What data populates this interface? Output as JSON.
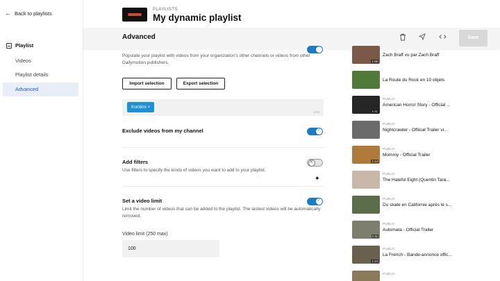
{
  "sidebar": {
    "back_label": "Back to playlists",
    "section_label": "Playlist",
    "items": [
      {
        "label": "Videos"
      },
      {
        "label": "Playlist details"
      },
      {
        "label": "Advanced"
      }
    ]
  },
  "header": {
    "breadcrumb": "PLAYLISTS",
    "title": "My dynamic playlist"
  },
  "toolbar": {
    "section_title": "Advanced",
    "save_label": "Save"
  },
  "main": {
    "intro": "Populate your playlist with videos from your organization's other channels or videos from other Dailymotion publishers.",
    "import_label": "Import selection",
    "export_label": "Export selection",
    "tag": "Konbini ×",
    "tag_counter": "1/10",
    "exclude_title": "Exclude videos from my channel",
    "filters_title": "Add filters",
    "filters_desc": "Use filters to specify the kinds of videos you want to add to your playlist.",
    "limit_title": "Set a video limit",
    "limit_desc": "Limit the number of videos that can be added to the playlist. The lastest videos will be automatically removed.",
    "limit_field_label": "Video limit (250 max)",
    "limit_value": "100"
  },
  "videos": [
    {
      "status": "",
      "title": "Zach Braff vu par Zach Braff",
      "duration": "1:08",
      "color": "#7a5a46"
    },
    {
      "status": "",
      "title": "La Route du Rock en 10 objets",
      "duration": "",
      "color": "#4f7a3a"
    },
    {
      "status": "PUBLIC",
      "title": "American Horror Story - Official ...",
      "duration": "1:11",
      "color": "#262626"
    },
    {
      "status": "PUBLIC",
      "title": "Nightcrawler - Official Trailer vi...",
      "duration": "",
      "color": "#6b6b6b"
    },
    {
      "status": "PUBLIC",
      "title": "Mommy - Official Trailer",
      "duration": "1:14",
      "color": "#b07a3a"
    },
    {
      "status": "PUBLIC",
      "title": "The Hateful Eight (Quentin Tara...",
      "duration": "",
      "color": "#c9b8a8"
    },
    {
      "status": "PUBLIC",
      "title": "Du skate en Californie après le s...",
      "duration": "",
      "color": "#5b6d4a"
    },
    {
      "status": "PUBLIC",
      "title": "Automata - Official Trailer",
      "duration": "1:11",
      "color": "#7e7e6e"
    },
    {
      "status": "PUBLIC",
      "title": "La French - Bande-annonce offic...",
      "duration": "1:13",
      "color": "#6a6050"
    },
    {
      "status": "PUBLIC",
      "title": "",
      "duration": "",
      "color": "#8a7a5a"
    }
  ],
  "colors": {
    "accent": "#1a7cc8",
    "active_nav_bg": "#e8eef7",
    "save_disabled": "#d8d8d8"
  },
  "toggles": {
    "intro_toggle": "on",
    "exclude": "on",
    "filters": "off",
    "limit": "on"
  }
}
